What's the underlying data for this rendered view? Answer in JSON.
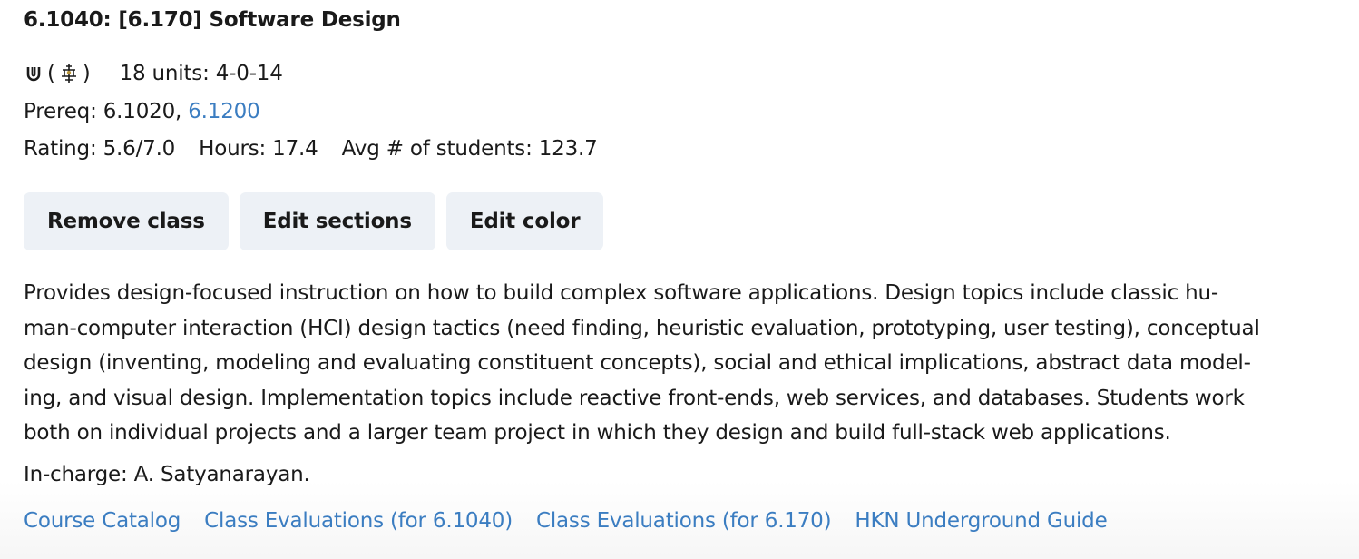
{
  "course": {
    "title": "6.1040: [6.170] Software Design",
    "level_icon": "undergrad-u-icon",
    "institute_lab_icon": "institute-lab-icon",
    "paren_open": "(",
    "paren_close": ")",
    "units": "18 units: 4-0-14",
    "prereq_label": "Prereq: 6.1020, ",
    "prereq_link": "6.1200",
    "rating": "Rating: 5.6/7.0",
    "hours": "Hours: 17.4",
    "avg_students": "Avg # of students: 123.7"
  },
  "buttons": {
    "remove": "Remove class",
    "edit_sections": "Edit sections",
    "edit_color": "Edit color"
  },
  "description": "Provides design-focused instruction on how to build complex software applications. Design topics include classic hu-\nman-computer interaction (HCI) design tactics (need finding, heuristic evaluation, prototyping, user testing), conceptual\ndesign (inventing, modeling and evaluating constituent concepts), social and ethical implications, abstract data model-\ning, and visual design. Implementation topics include reactive front-ends, web services, and databases. Students work\nboth on individual projects and a larger team project in which they design and build full-stack web applications.",
  "in_charge": "In-charge: A. Satyanarayan.",
  "links": {
    "catalog": "Course Catalog",
    "eval_new": "Class Evaluations (for 6.1040)",
    "eval_old": "Class Evaluations (for 6.170)",
    "hkn": "HKN Underground Guide"
  },
  "colors": {
    "link": "#3b7dc1",
    "button_bg": "#edf1f6",
    "text": "#1a1a1a"
  }
}
